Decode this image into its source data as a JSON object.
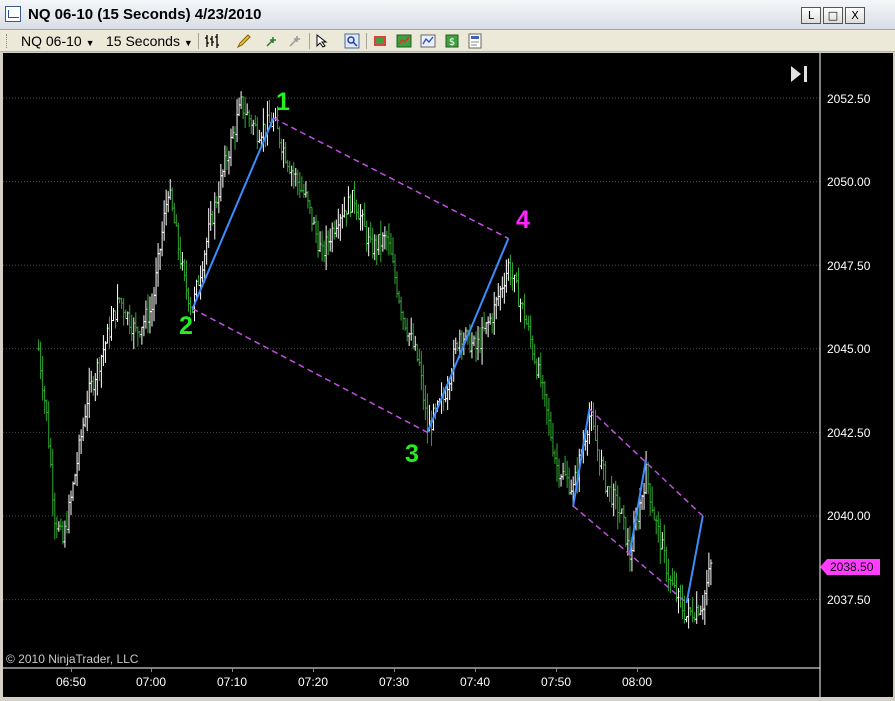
{
  "window": {
    "title": "NQ 06-10 (15 Seconds)  4/23/2010",
    "buttons": [
      "L",
      "□",
      "X"
    ]
  },
  "toolbar": {
    "instrument": "NQ 06-10",
    "period": "15 Seconds",
    "icons": [
      "bar-style-icon",
      "drawing-tools-icon",
      "crosshair-icon",
      "pan-icon",
      "select-icon",
      "zoom-icon",
      "strategy-icon",
      "indicator-icon",
      "chart-properties-icon",
      "money-icon",
      "data-box-icon"
    ]
  },
  "chart": {
    "copyright": "© 2010 NinjaTrader, LLC",
    "current_price": "2038.50",
    "y_axis_labels": [
      "2052.50",
      "2050.00",
      "2047.50",
      "2045.00",
      "2042.50",
      "2040.00",
      "2037.50"
    ],
    "x_axis_labels": [
      "06:50",
      "07:00",
      "07:10",
      "07:20",
      "07:30",
      "07:40",
      "07:50",
      "08:00"
    ],
    "wave_labels": [
      "1",
      "2",
      "3",
      "4"
    ],
    "colors": {
      "background": "#000000",
      "bars": "#ffffff",
      "bars_down": "#2fa82f",
      "impulse_line": "#3c8cff",
      "channel_line": "#c050e0",
      "wave_label_green": "#22ee22",
      "wave_label_magenta": "#ff22ff",
      "price_marker": "#ff3cff"
    }
  },
  "chart_data": {
    "type": "candlestick",
    "title": "NQ 06-10 (15 Seconds)  4/23/2010",
    "xlabel": "",
    "ylabel": "",
    "ylim": [
      2035.0,
      2054.0
    ],
    "y_ticks": [
      2037.5,
      2040.0,
      2042.5,
      2045.0,
      2047.5,
      2050.0,
      2052.5
    ],
    "x_ticks": [
      "06:50",
      "07:00",
      "07:10",
      "07:20",
      "07:30",
      "07:40",
      "07:50",
      "08:00"
    ],
    "last_price": 2038.5,
    "price_path": [
      {
        "t": "06:46",
        "p": 2045.0
      },
      {
        "t": "06:47",
        "p": 2043.0
      },
      {
        "t": "06:48",
        "p": 2040.0
      },
      {
        "t": "06:49",
        "p": 2039.2
      },
      {
        "t": "06:50",
        "p": 2040.5
      },
      {
        "t": "06:52",
        "p": 2043.5
      },
      {
        "t": "06:54",
        "p": 2045.0
      },
      {
        "t": "06:56",
        "p": 2046.5
      },
      {
        "t": "06:58",
        "p": 2045.5
      },
      {
        "t": "07:00",
        "p": 2046.2
      },
      {
        "t": "07:02",
        "p": 2049.8
      },
      {
        "t": "07:04",
        "p": 2047.0
      },
      {
        "t": "07:05",
        "p": 2046.2
      },
      {
        "t": "07:07",
        "p": 2048.5
      },
      {
        "t": "07:09",
        "p": 2050.5
      },
      {
        "t": "07:11",
        "p": 2052.3
      },
      {
        "t": "07:13",
        "p": 2051.5
      },
      {
        "t": "07:15",
        "p": 2051.8
      },
      {
        "t": "07:17",
        "p": 2050.5
      },
      {
        "t": "07:19",
        "p": 2049.5
      },
      {
        "t": "07:21",
        "p": 2047.8
      },
      {
        "t": "07:23",
        "p": 2049.0
      },
      {
        "t": "07:25",
        "p": 2049.5
      },
      {
        "t": "07:27",
        "p": 2048.0
      },
      {
        "t": "07:29",
        "p": 2048.3
      },
      {
        "t": "07:31",
        "p": 2046.0
      },
      {
        "t": "07:33",
        "p": 2044.5
      },
      {
        "t": "07:34",
        "p": 2042.6
      },
      {
        "t": "07:36",
        "p": 2043.5
      },
      {
        "t": "07:38",
        "p": 2045.5
      },
      {
        "t": "07:40",
        "p": 2045.0
      },
      {
        "t": "07:42",
        "p": 2046.0
      },
      {
        "t": "07:44",
        "p": 2047.5
      },
      {
        "t": "07:46",
        "p": 2046.0
      },
      {
        "t": "07:48",
        "p": 2044.0
      },
      {
        "t": "07:50",
        "p": 2041.5
      },
      {
        "t": "07:52",
        "p": 2040.8
      },
      {
        "t": "07:54",
        "p": 2043.0
      },
      {
        "t": "07:56",
        "p": 2041.0
      },
      {
        "t": "07:58",
        "p": 2040.0
      },
      {
        "t": "07:59",
        "p": 2038.8
      },
      {
        "t": "08:01",
        "p": 2041.3
      },
      {
        "t": "08:02",
        "p": 2040.0
      },
      {
        "t": "08:04",
        "p": 2038.0
      },
      {
        "t": "08:06",
        "p": 2037.0
      },
      {
        "t": "08:08",
        "p": 2037.4
      },
      {
        "t": "08:09",
        "p": 2038.5
      }
    ],
    "annotations": [
      {
        "type": "impulse",
        "from": {
          "t": "07:05",
          "p": 2046.2
        },
        "to": {
          "t": "07:15",
          "p": 2051.9
        }
      },
      {
        "type": "channel",
        "from": {
          "t": "07:15",
          "p": 2051.9
        },
        "to": {
          "t": "07:44",
          "p": 2048.3
        }
      },
      {
        "type": "channel",
        "from": {
          "t": "07:05",
          "p": 2046.2
        },
        "to": {
          "t": "07:34",
          "p": 2042.5
        }
      },
      {
        "type": "impulse",
        "from": {
          "t": "07:34",
          "p": 2042.5
        },
        "to": {
          "t": "07:44",
          "p": 2048.3
        }
      },
      {
        "type": "impulse",
        "from": {
          "t": "07:52",
          "p": 2040.3
        },
        "to": {
          "t": "07:54",
          "p": 2043.2
        }
      },
      {
        "type": "impulse",
        "from": {
          "t": "07:59",
          "p": 2038.9
        },
        "to": {
          "t": "08:01",
          "p": 2041.7
        }
      },
      {
        "type": "impulse",
        "from": {
          "t": "08:06",
          "p": 2037.4
        },
        "to": {
          "t": "08:08",
          "p": 2040.0
        }
      },
      {
        "type": "channel",
        "from": {
          "t": "07:54",
          "p": 2043.2
        },
        "to": {
          "t": "08:08",
          "p": 2040.0
        }
      },
      {
        "type": "channel",
        "from": {
          "t": "07:52",
          "p": 2040.3
        },
        "to": {
          "t": "08:06",
          "p": 2037.4
        }
      }
    ],
    "wave_points": [
      {
        "label": "1",
        "t": "07:15",
        "p": 2051.9
      },
      {
        "label": "2",
        "t": "07:05",
        "p": 2046.2
      },
      {
        "label": "3",
        "t": "07:34",
        "p": 2042.5
      },
      {
        "label": "4",
        "t": "07:44",
        "p": 2048.3
      }
    ]
  }
}
